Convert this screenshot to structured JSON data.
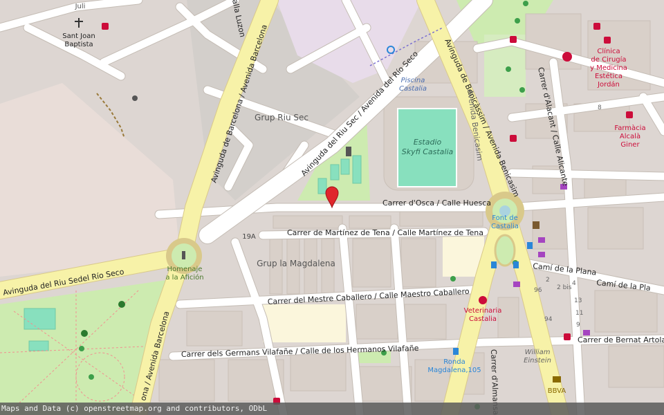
{
  "colors": {
    "background": "#ddd6d2",
    "building": "#d9d0c9",
    "primary_road": "#f7f2a8",
    "primary_casing": "#d9c98a",
    "road": "#ffffff",
    "park": "#cdebb0",
    "pitch": "#88e0be",
    "residential": "#e2dbd3",
    "school_area": "#fbf6dc",
    "marker": "#e0262c",
    "health": "#cc0c3a",
    "label_text": "#555555",
    "transit": "#2a86d8"
  },
  "streets": {
    "avinguda_barcelona_upper": "Avinguda de Barcelona / Avenida Barcelona",
    "avinguda_barcelona_lower": "ona / Avenida Barcelona",
    "riu_sec_diagonal": "Avinguda del Riu Sec / Avenida del Río Seco",
    "riu_sec_horizontal": "Avinguda del Riu Sedel Río Seco",
    "benicassim": "Avinguda de Benicàssim / Avenida Benicasim",
    "benicassim_short": "Avenida Benicasim",
    "osca": "Carrer d'Osca / Calle Huesca",
    "martinez_tena": "Carrer de Martínez de Tena / Calle Martínez de Tena",
    "mestre_caballero": "Carrer del Mestre Caballero / Calle Maestro Caballero",
    "germans_vilafane": "Carrer dels Germans Vilafañe / Calle de los Hermanos Vilafañe",
    "alacant": "Carrer d'Alacant / Calle Alicante",
    "cami_plana": "Camí de la Plana",
    "cami_plana_2": "Camí de la Pla",
    "bernat_artola": "Carrer de Bernat Artola / Ca",
    "almansa": "Carrer d'Almansa / ...",
    "luzon": "alla Luzon"
  },
  "places": {
    "juli": "Juli",
    "sant_joan": "Sant Joan\nBaptista",
    "grup_riu_sec": "Grup Riu Sec",
    "grup_magdalena": "Grup la Magdalena",
    "piscina": "Piscina\nCastalia",
    "estadio": "Estadio\nSkyfi Castalia",
    "font_castalia": "Font de\nCastalia",
    "homenaje": "Homenaje\na la Afición",
    "clinica": "Clínica\nde Cirugía\ny Medicina\nEstética\nJordán",
    "farmacia": "Farmàcia\nAlcalà\nGiner",
    "veterinaria": "Veterinaria\nCastalia",
    "william": "William\nEinstein",
    "ronda": "Ronda\nMagdalena,105",
    "bbva": "BBVA",
    "ref_19a": "19A"
  },
  "house_numbers": [
    "8",
    "96",
    "94",
    "2 bis",
    "2",
    "4",
    "13",
    "11",
    "9"
  ],
  "marker": {
    "icon": "map-pin-icon"
  },
  "attribution": "Maps and Data (c) openstreetmap.org and contributors, ODbL"
}
